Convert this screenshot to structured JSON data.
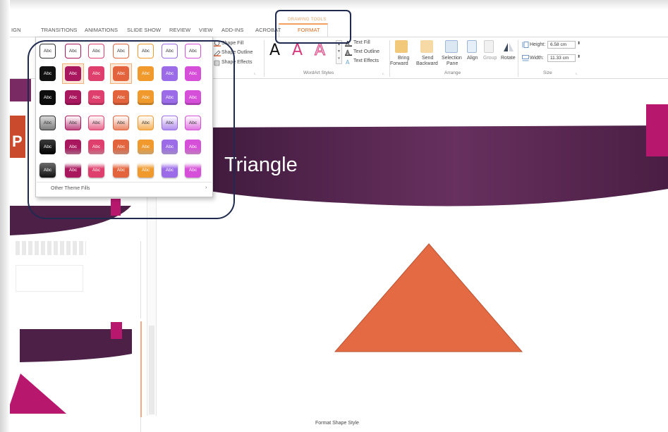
{
  "app": {
    "name": "PowerPoint"
  },
  "contextual_tab_group": "DRAWING TOOLS",
  "tabs": [
    {
      "label": "IGN"
    },
    {
      "label": "TRANSITIONS"
    },
    {
      "label": "ANIMATIONS"
    },
    {
      "label": "SLIDE SHOW"
    },
    {
      "label": "REVIEW"
    },
    {
      "label": "VIEW"
    },
    {
      "label": "ADD-INS"
    },
    {
      "label": "ACROBAT"
    },
    {
      "label": "FORMAT",
      "active": true
    }
  ],
  "ribbon": {
    "shape_fill": "Shape Fill",
    "shape_outline": "Shape Outline",
    "shape_effects": "Shape Effects",
    "wordart_letter": "A",
    "wordart_group": "WordArt Styles",
    "text_fill": "Text Fill",
    "text_outline": "Text Outline",
    "text_effects": "Text Effects",
    "bring_forward_1": "Bring",
    "bring_forward_2": "Forward",
    "send_backward_1": "Send",
    "send_backward_2": "Backward",
    "selection_pane_1": "Selection",
    "selection_pane_2": "Pane",
    "align": "Align",
    "group": "Group",
    "rotate": "Rotate",
    "arrange_group": "Arrange",
    "height_label": "Height:",
    "height_value": "6.58 cm",
    "width_label": "Width:",
    "width_value": "11.33 cm",
    "size_group": "Size"
  },
  "gallery": {
    "cell_text": "Abc",
    "other_theme_fills": "Other Theme Fills",
    "more_arrow": "›"
  },
  "slide": {
    "title": "Triangle"
  },
  "status": "Format Shape Style",
  "colors": {
    "accent_orange": "#e36a43",
    "theme_purple": "#4c2047",
    "theme_magenta": "#b7186e",
    "tab_active": "#d76b1f",
    "callout": "#1f2a4e"
  }
}
